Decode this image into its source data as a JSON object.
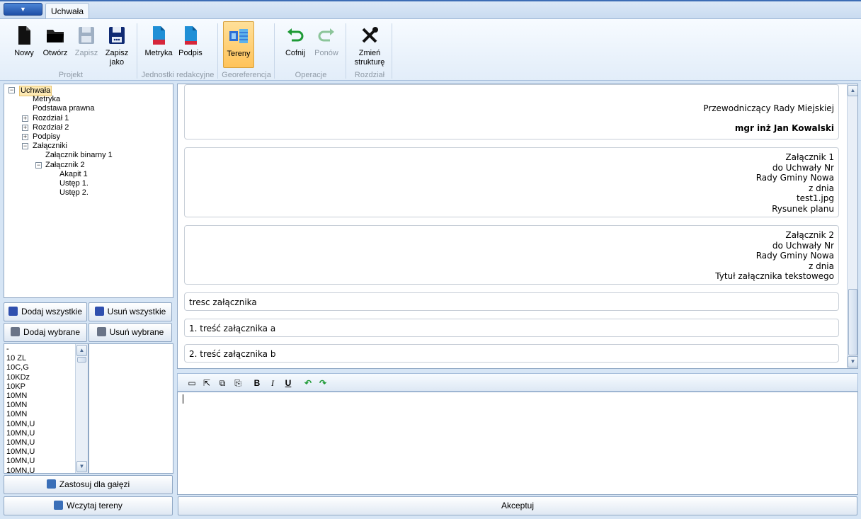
{
  "tabs": [
    {
      "label": "Uchwała"
    }
  ],
  "ribbon": {
    "groups": [
      {
        "label": "Projekt",
        "buttons": [
          {
            "label": "Nowy",
            "icon": "new-document-icon",
            "enabled": true
          },
          {
            "label": "Otwórz",
            "icon": "open-folder-icon",
            "enabled": true
          },
          {
            "label": "Zapisz",
            "icon": "save-icon",
            "enabled": false
          },
          {
            "label": "Zapisz jako",
            "icon": "save-as-icon",
            "enabled": true
          }
        ]
      },
      {
        "label": "Jednostki redakcyjne",
        "buttons": [
          {
            "label": "Metryka",
            "icon": "metadata-icon",
            "enabled": true
          },
          {
            "label": "Podpis",
            "icon": "signature-icon",
            "enabled": true
          }
        ]
      },
      {
        "label": "Georeferencja",
        "buttons": [
          {
            "label": "Tereny",
            "icon": "terrain-icon",
            "enabled": true,
            "active": true
          }
        ]
      },
      {
        "label": "Operacje",
        "buttons": [
          {
            "label": "Cofnij",
            "icon": "undo-icon",
            "enabled": true
          },
          {
            "label": "Ponów",
            "icon": "redo-icon",
            "enabled": false
          }
        ]
      },
      {
        "label": "Rozdział",
        "buttons": [
          {
            "label": "Zmień strukturę",
            "icon": "tools-icon",
            "enabled": true
          }
        ]
      }
    ]
  },
  "tree": {
    "nodes": [
      {
        "label": "Uchwała",
        "level": 0,
        "toggle": "−",
        "selected": true
      },
      {
        "label": "Metryka",
        "level": 1
      },
      {
        "label": "Podstawa prawna",
        "level": 1
      },
      {
        "label": "Rozdział 1",
        "level": 1,
        "toggle": "+"
      },
      {
        "label": "Rozdział 2",
        "level": 1,
        "toggle": "+"
      },
      {
        "label": "Podpisy",
        "level": 1,
        "toggle": "+"
      },
      {
        "label": "Załączniki",
        "level": 1,
        "toggle": "−"
      },
      {
        "label": "Załącznik binarny 1",
        "level": 2
      },
      {
        "label": "Załącznik 2",
        "level": 2,
        "toggle": "−"
      },
      {
        "label": "Akapit 1",
        "level": 3
      },
      {
        "label": "Ustęp 1.",
        "level": 3
      },
      {
        "label": "Ustęp 2.",
        "level": 3
      }
    ]
  },
  "actions": {
    "add_all": "Dodaj wszystkie",
    "remove_all": "Usuń wszystkie",
    "add_selected": "Dodaj wybrane",
    "remove_selected": "Usuń wybrane",
    "apply_branch": "Zastosuj dla gałęzi",
    "load_terrains": "Wczytaj tereny",
    "accept": "Akceptuj"
  },
  "terrain_list": [
    "-",
    "10 ZL",
    "10C,G",
    "10KDz",
    "10KP",
    "10MN",
    "10MN",
    "10MN",
    "10MN,U",
    "10MN,U",
    "10MN,U",
    "10MN,U",
    "10MN,U",
    "10MN,U"
  ],
  "document": {
    "signature": {
      "title": "Przewodniczący Rady Miejskiej",
      "name": "mgr inż Jan Kowalski"
    },
    "attachment1": [
      "Załącznik 1",
      "do Uchwały Nr",
      "Rady Gminy Nowa",
      "z dnia",
      "test1.jpg",
      "Rysunek  planu"
    ],
    "attachment2": [
      "Załącznik 2",
      "do Uchwały Nr",
      "Rady Gminy Nowa",
      "z dnia",
      "Tytuł załącznika tekstowego"
    ],
    "content": [
      "tresc załącznika",
      "1. treść załącznika a",
      "2. treść załącznika  b"
    ]
  },
  "editor_toolbar": {
    "bold": "B",
    "italic": "I",
    "underline": "U"
  },
  "colors": {
    "accent": "#3d6db5",
    "ribbon_active": "#ffc35a",
    "panel_border": "#8fa7c4"
  }
}
